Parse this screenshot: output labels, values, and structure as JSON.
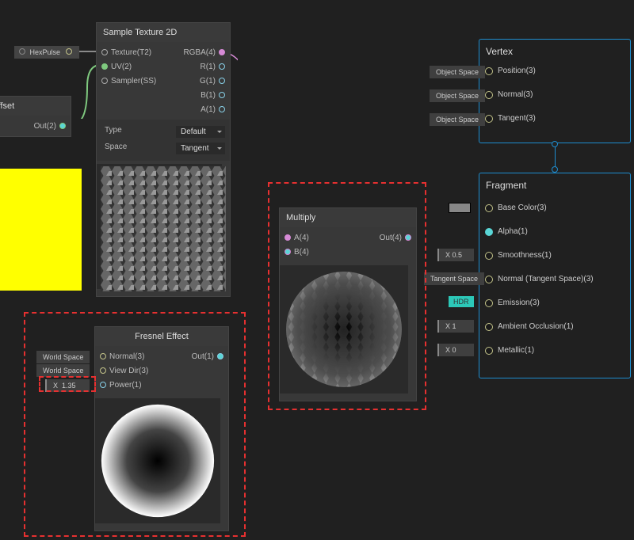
{
  "hexpulse_label": "HexPulse",
  "offset": {
    "title": "Offset",
    "out": "Out(2)"
  },
  "sample_texture": {
    "title": "Sample Texture 2D",
    "inputs": {
      "texture": "Texture(T2)",
      "uv": "UV(2)",
      "sampler": "Sampler(SS)"
    },
    "outputs": {
      "rgba": "RGBA(4)",
      "r": "R(1)",
      "g": "G(1)",
      "b": "B(1)",
      "a": "A(1)"
    },
    "params": {
      "type_label": "Type",
      "type_value": "Default",
      "space_label": "Space",
      "space_value": "Tangent"
    }
  },
  "fresnel": {
    "title": "Fresnel Effect",
    "inputs": {
      "normal": "Normal(3)",
      "viewdir": "View Dir(3)",
      "power": "Power(1)"
    },
    "output": "Out(1)",
    "normal_tag": "World Space",
    "viewdir_tag": "World Space",
    "power_x": "X",
    "power_value": "1.35"
  },
  "multiply": {
    "title": "Multiply",
    "a": "A(4)",
    "b": "B(4)",
    "out": "Out(4)"
  },
  "vertex": {
    "title": "Vertex",
    "rows": [
      {
        "tag": "Object Space",
        "label": "Position(3)"
      },
      {
        "tag": "Object Space",
        "label": "Normal(3)"
      },
      {
        "tag": "Object Space",
        "label": "Tangent(3)"
      }
    ]
  },
  "fragment": {
    "title": "Fragment",
    "basecolor": "Base Color(3)",
    "alpha": "Alpha(1)",
    "smooth": "Smoothness(1)",
    "smooth_val": "0.5",
    "normal": "Normal (Tangent Space)(3)",
    "normal_tag": "Tangent Space",
    "emission": "Emission(3)",
    "emission_tag": "HDR",
    "ao": "Ambient Occlusion(1)",
    "ao_val": "1",
    "metallic": "Metallic(1)",
    "metallic_val": "0",
    "x": "X"
  }
}
